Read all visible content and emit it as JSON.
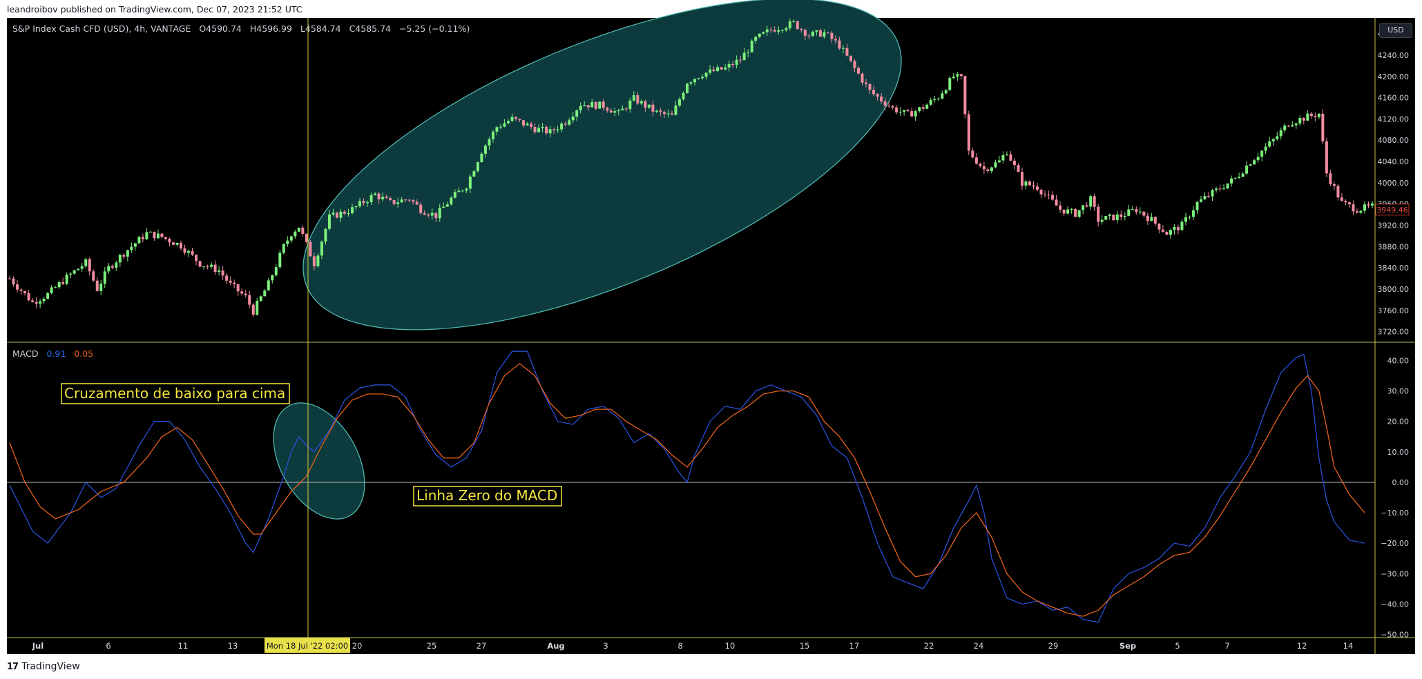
{
  "publisher_line": "leandroibov published on TradingView.com, Dec 07, 2023 21:52 UTC",
  "brand": "TradingView",
  "currency_button": "USD",
  "header": {
    "symbol": "S&P Index Cash CFD (USD), 4h, VANTAGE",
    "open": "O4590.74",
    "high": "H4596.99",
    "low": "L4584.74",
    "close": "C4585.74",
    "change": "−5.25 (−0.11%)"
  },
  "macd_header": {
    "name": "MACD",
    "macd_value": "0.91",
    "signal_value": "0.05"
  },
  "annotations": {
    "crossover": "Cruzamento de baixo para cima",
    "zero_line": "Linha Zero do MACD"
  },
  "crosshair_label": "Mon 18 Jul '22   02:00",
  "last_price_label": "3949.46",
  "colors": {
    "background": "#000000",
    "up_candle": "#7cf07c",
    "down_candle": "#f28ca0",
    "macd_line": "#2a4fd6",
    "signal_line": "#e8621c",
    "crosshair": "#e8e04a",
    "ellipse_fill": "#0d3b3d",
    "ellipse_stroke": "#4fb8b0",
    "annotation_text": "#f5e640"
  },
  "chart_data": [
    {
      "type": "candlestick",
      "title": "S&P Index Cash CFD (USD), 4h, VANTAGE",
      "y_axis_ticks": [
        3720,
        3760,
        3800,
        3840,
        3880,
        3920,
        3960,
        4000,
        4040,
        4080,
        4120,
        4160,
        4200,
        4240,
        4280
      ],
      "ylim": [
        3700,
        4310
      ],
      "x_axis_ticks": [
        "Jul",
        "6",
        "11",
        "13",
        "18",
        "20",
        "25",
        "27",
        "Aug",
        "3",
        "8",
        "10",
        "15",
        "17",
        "22",
        "24",
        "29",
        "Sep",
        "5",
        "7",
        "12",
        "14"
      ],
      "close_path": [
        [
          0,
          3820
        ],
        [
          6,
          3775
        ],
        [
          10,
          3790
        ],
        [
          15,
          3822
        ],
        [
          20,
          3850
        ],
        [
          23,
          3800
        ],
        [
          26,
          3840
        ],
        [
          30,
          3868
        ],
        [
          36,
          3905
        ],
        [
          40,
          3898
        ],
        [
          45,
          3882
        ],
        [
          50,
          3848
        ],
        [
          55,
          3835
        ],
        [
          58,
          3808
        ],
        [
          62,
          3785
        ],
        [
          64,
          3758
        ],
        [
          68,
          3810
        ],
        [
          72,
          3880
        ],
        [
          74,
          3905
        ],
        [
          76,
          3918
        ],
        [
          80,
          3848
        ],
        [
          84,
          3935
        ],
        [
          90,
          3950
        ],
        [
          96,
          3978
        ],
        [
          100,
          3962
        ],
        [
          105,
          3970
        ],
        [
          108,
          3950
        ],
        [
          112,
          3938
        ],
        [
          116,
          3970
        ],
        [
          120,
          3995
        ],
        [
          124,
          4060
        ],
        [
          128,
          4105
        ],
        [
          132,
          4120
        ],
        [
          138,
          4102
        ],
        [
          142,
          4095
        ],
        [
          146,
          4115
        ],
        [
          150,
          4148
        ],
        [
          156,
          4145
        ],
        [
          160,
          4130
        ],
        [
          164,
          4158
        ],
        [
          170,
          4132
        ],
        [
          174,
          4125
        ],
        [
          178,
          4190
        ],
        [
          182,
          4205
        ],
        [
          188,
          4215
        ],
        [
          192,
          4232
        ],
        [
          196,
          4270
        ],
        [
          200,
          4288
        ],
        [
          206,
          4300
        ],
        [
          210,
          4278
        ],
        [
          214,
          4282
        ],
        [
          218,
          4258
        ],
        [
          222,
          4215
        ],
        [
          226,
          4172
        ],
        [
          232,
          4140
        ],
        [
          236,
          4128
        ],
        [
          240,
          4142
        ],
        [
          244,
          4162
        ],
        [
          248,
          4200
        ],
        [
          250,
          4195
        ],
        [
          252,
          4058
        ],
        [
          256,
          4025
        ],
        [
          260,
          4040
        ],
        [
          262,
          4060
        ],
        [
          266,
          4000
        ],
        [
          270,
          3992
        ],
        [
          276,
          3950
        ],
        [
          280,
          3942
        ],
        [
          284,
          3968
        ],
        [
          286,
          3930
        ],
        [
          292,
          3938
        ],
        [
          296,
          3950
        ],
        [
          300,
          3930
        ],
        [
          304,
          3905
        ],
        [
          308,
          3920
        ],
        [
          312,
          3962
        ],
        [
          318,
          3990
        ],
        [
          322,
          4008
        ],
        [
          326,
          4040
        ],
        [
          332,
          4080
        ],
        [
          336,
          4112
        ],
        [
          340,
          4122
        ],
        [
          344,
          4130
        ],
        [
          346,
          4018
        ],
        [
          350,
          3962
        ],
        [
          354,
          3950
        ],
        [
          358,
          3955
        ]
      ],
      "last_price": 3949.46
    },
    {
      "type": "line",
      "title": "MACD",
      "series": [
        {
          "name": "MACD",
          "color": "#2a4fd6",
          "points": [
            [
              0,
              -1
            ],
            [
              6,
              -16
            ],
            [
              10,
              -20
            ],
            [
              16,
              -10
            ],
            [
              20,
              0
            ],
            [
              24,
              -5
            ],
            [
              28,
              -2
            ],
            [
              34,
              12
            ],
            [
              38,
              20
            ],
            [
              42,
              20
            ],
            [
              46,
              14
            ],
            [
              50,
              5
            ],
            [
              54,
              -2
            ],
            [
              58,
              -10
            ],
            [
              62,
              -20
            ],
            [
              64,
              -23
            ],
            [
              68,
              -12
            ],
            [
              72,
              2
            ],
            [
              74,
              10
            ],
            [
              76,
              15
            ],
            [
              78,
              12
            ],
            [
              80,
              10
            ],
            [
              84,
              17
            ],
            [
              88,
              27
            ],
            [
              92,
              31
            ],
            [
              96,
              32
            ],
            [
              100,
              32
            ],
            [
              104,
              28
            ],
            [
              108,
              17
            ],
            [
              112,
              9
            ],
            [
              116,
              5
            ],
            [
              120,
              8
            ],
            [
              124,
              17
            ],
            [
              128,
              36
            ],
            [
              132,
              43
            ],
            [
              136,
              43
            ],
            [
              140,
              30
            ],
            [
              144,
              20
            ],
            [
              148,
              19
            ],
            [
              152,
              24
            ],
            [
              156,
              25
            ],
            [
              160,
              21
            ],
            [
              164,
              13
            ],
            [
              168,
              16
            ],
            [
              172,
              11
            ],
            [
              176,
              3
            ],
            [
              178,
              0
            ],
            [
              180,
              9
            ],
            [
              184,
              20
            ],
            [
              188,
              25
            ],
            [
              192,
              24
            ],
            [
              196,
              30
            ],
            [
              200,
              32
            ],
            [
              204,
              30
            ],
            [
              208,
              28
            ],
            [
              212,
              22
            ],
            [
              216,
              12
            ],
            [
              220,
              8
            ],
            [
              224,
              -5
            ],
            [
              228,
              -20
            ],
            [
              232,
              -31
            ],
            [
              236,
              -33
            ],
            [
              240,
              -35
            ],
            [
              244,
              -27
            ],
            [
              248,
              -15
            ],
            [
              252,
              -6
            ],
            [
              254,
              -1
            ],
            [
              256,
              -10
            ],
            [
              258,
              -25
            ],
            [
              262,
              -38
            ],
            [
              266,
              -40
            ],
            [
              270,
              -39
            ],
            [
              274,
              -42
            ],
            [
              278,
              -41
            ],
            [
              282,
              -45
            ],
            [
              286,
              -46
            ],
            [
              290,
              -35
            ],
            [
              294,
              -30
            ],
            [
              298,
              -28
            ],
            [
              302,
              -25
            ],
            [
              306,
              -20
            ],
            [
              310,
              -21
            ],
            [
              314,
              -15
            ],
            [
              318,
              -5
            ],
            [
              322,
              2
            ],
            [
              326,
              10
            ],
            [
              330,
              24
            ],
            [
              334,
              36
            ],
            [
              338,
              41
            ],
            [
              340,
              42
            ],
            [
              342,
              30
            ],
            [
              344,
              8
            ],
            [
              346,
              -6
            ],
            [
              348,
              -13
            ],
            [
              352,
              -19
            ],
            [
              356,
              -20
            ]
          ]
        },
        {
          "name": "Signal",
          "color": "#e8621c",
          "points": [
            [
              0,
              13
            ],
            [
              4,
              0
            ],
            [
              8,
              -8
            ],
            [
              12,
              -12
            ],
            [
              18,
              -9
            ],
            [
              24,
              -3
            ],
            [
              30,
              0
            ],
            [
              36,
              8
            ],
            [
              40,
              15
            ],
            [
              44,
              18
            ],
            [
              48,
              14
            ],
            [
              52,
              6
            ],
            [
              56,
              -2
            ],
            [
              60,
              -11
            ],
            [
              64,
              -17
            ],
            [
              66,
              -17
            ],
            [
              70,
              -10
            ],
            [
              74,
              -3
            ],
            [
              78,
              2
            ],
            [
              82,
              12
            ],
            [
              86,
              21
            ],
            [
              90,
              27
            ],
            [
              94,
              29
            ],
            [
              98,
              29
            ],
            [
              102,
              28
            ],
            [
              106,
              22
            ],
            [
              110,
              14
            ],
            [
              114,
              8
            ],
            [
              118,
              8
            ],
            [
              122,
              13
            ],
            [
              126,
              26
            ],
            [
              130,
              35
            ],
            [
              134,
              39
            ],
            [
              138,
              35
            ],
            [
              142,
              26
            ],
            [
              146,
              21
            ],
            [
              150,
              22
            ],
            [
              154,
              24
            ],
            [
              158,
              24
            ],
            [
              162,
              20
            ],
            [
              166,
              17
            ],
            [
              170,
              14
            ],
            [
              174,
              9
            ],
            [
              178,
              5
            ],
            [
              182,
              11
            ],
            [
              186,
              18
            ],
            [
              190,
              22
            ],
            [
              194,
              25
            ],
            [
              198,
              29
            ],
            [
              202,
              30
            ],
            [
              206,
              30
            ],
            [
              210,
              28
            ],
            [
              214,
              20
            ],
            [
              218,
              15
            ],
            [
              222,
              8
            ],
            [
              226,
              -3
            ],
            [
              230,
              -15
            ],
            [
              234,
              -26
            ],
            [
              238,
              -31
            ],
            [
              242,
              -30
            ],
            [
              246,
              -24
            ],
            [
              250,
              -15
            ],
            [
              254,
              -10
            ],
            [
              258,
              -18
            ],
            [
              262,
              -30
            ],
            [
              266,
              -36
            ],
            [
              270,
              -39
            ],
            [
              274,
              -41
            ],
            [
              278,
              -43
            ],
            [
              282,
              -44
            ],
            [
              286,
              -42
            ],
            [
              290,
              -37
            ],
            [
              294,
              -34
            ],
            [
              298,
              -31
            ],
            [
              302,
              -27
            ],
            [
              306,
              -24
            ],
            [
              310,
              -23
            ],
            [
              314,
              -18
            ],
            [
              318,
              -11
            ],
            [
              322,
              -3
            ],
            [
              326,
              5
            ],
            [
              330,
              14
            ],
            [
              334,
              23
            ],
            [
              338,
              31
            ],
            [
              341,
              35
            ],
            [
              344,
              30
            ],
            [
              346,
              18
            ],
            [
              348,
              5
            ],
            [
              352,
              -4
            ],
            [
              356,
              -10
            ]
          ]
        }
      ],
      "y_axis_ticks": [
        -50,
        -40,
        -30,
        -20,
        -10,
        0,
        10,
        20,
        30,
        40
      ],
      "ylim": [
        -51,
        46
      ],
      "zero_line": 0
    }
  ]
}
